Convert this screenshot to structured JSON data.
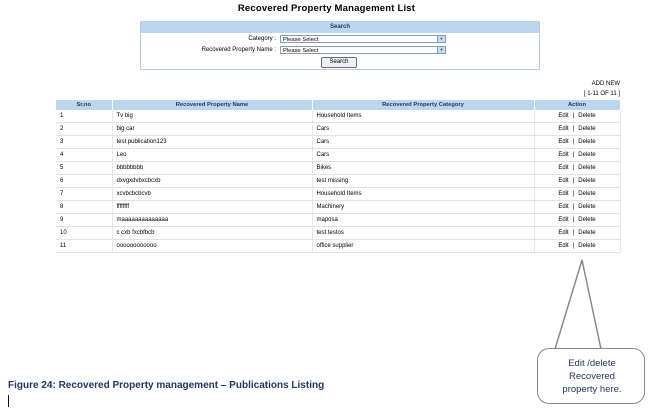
{
  "page": {
    "title": "Recovered Property Management List"
  },
  "search": {
    "header": "Search",
    "category_label": "Category :",
    "category_value": "Please Select",
    "property_label": "Recovered Property Name :",
    "property_value": "Please Select",
    "button": "Search"
  },
  "add_new": "ADD NEW",
  "pager": "[ 1-11 OF 11 ]",
  "table": {
    "headers": [
      "Sr.no",
      "Recovered Property Name",
      "Recovered Property Category",
      "Action"
    ],
    "rows": [
      {
        "no": "1",
        "name": "Tv big",
        "category": "Household Items"
      },
      {
        "no": "2",
        "name": "big car",
        "category": "Cars"
      },
      {
        "no": "3",
        "name": "test publication123",
        "category": "Cars"
      },
      {
        "no": "4",
        "name": "Leo",
        "category": "Cars"
      },
      {
        "no": "5",
        "name": "bbbbbbbb",
        "category": "Bikes"
      },
      {
        "no": "6",
        "name": "dxvgxdvbxcbcxb",
        "category": "test missing"
      },
      {
        "no": "7",
        "name": "xcvbcbcbcvb",
        "category": "Household Items"
      },
      {
        "no": "8",
        "name": "ffffffff",
        "category": "Machinery"
      },
      {
        "no": "9",
        "name": "maaaaaaaaaaaaaa",
        "category": "maposa"
      },
      {
        "no": "10",
        "name": "c cxb fxcbfbcb",
        "category": "test testos"
      },
      {
        "no": "11",
        "name": "oooooooooooo",
        "category": "office supplier"
      }
    ],
    "edit_label": "Edit",
    "separator": "|",
    "delete_label": "Delete"
  },
  "callout": {
    "lines": [
      "Edit /delete",
      "Recovered",
      "property here."
    ]
  },
  "caption": "Figure 24: Recovered Property management – Publications Listing"
}
